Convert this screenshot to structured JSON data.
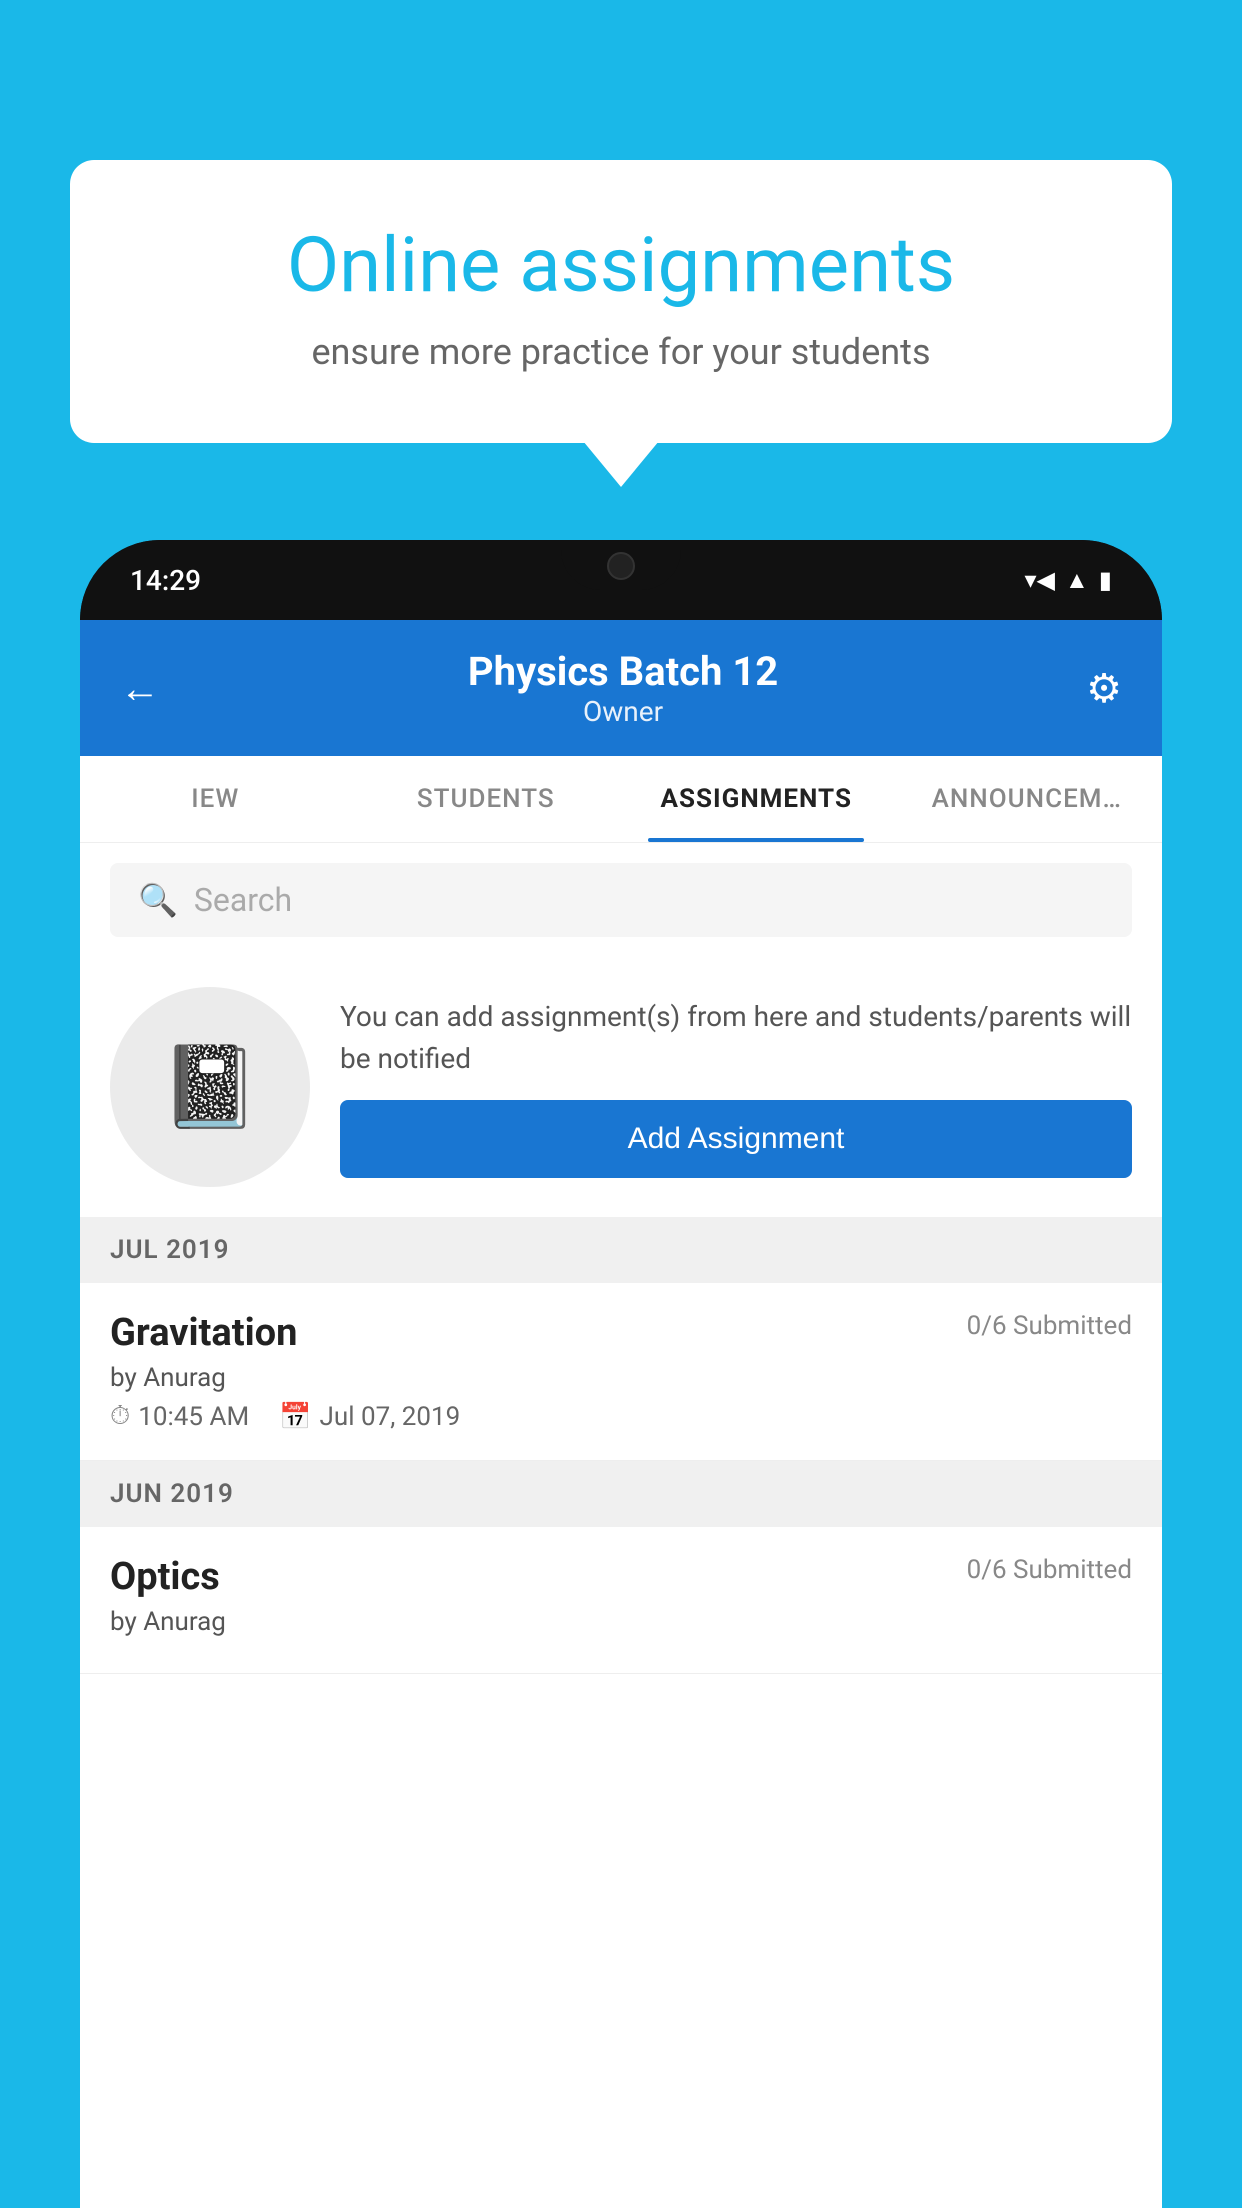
{
  "background": {
    "color": "#1ab8e8"
  },
  "speech_bubble": {
    "title": "Online assignments",
    "subtitle": "ensure more practice for your students"
  },
  "phone": {
    "status_bar": {
      "time": "14:29",
      "wifi": "▾",
      "signal": "▴",
      "battery": "▮"
    },
    "header": {
      "back_label": "←",
      "title": "Physics Batch 12",
      "subtitle": "Owner",
      "settings_label": "⚙"
    },
    "tabs": [
      {
        "label": "IEW",
        "active": false
      },
      {
        "label": "STUDENTS",
        "active": false
      },
      {
        "label": "ASSIGNMENTS",
        "active": true
      },
      {
        "label": "ANNOUNCEM…",
        "active": false
      }
    ],
    "search": {
      "placeholder": "Search"
    },
    "empty_state": {
      "description": "You can add assignment(s) from here and students/parents will be notified",
      "button_label": "Add Assignment"
    },
    "sections": [
      {
        "month_label": "JUL 2019",
        "assignments": [
          {
            "title": "Gravitation",
            "submitted": "0/6 Submitted",
            "by": "by Anurag",
            "time": "10:45 AM",
            "date": "Jul 07, 2019"
          }
        ]
      },
      {
        "month_label": "JUN 2019",
        "assignments": [
          {
            "title": "Optics",
            "submitted": "0/6 Submitted",
            "by": "by Anurag",
            "time": "",
            "date": ""
          }
        ]
      }
    ]
  }
}
